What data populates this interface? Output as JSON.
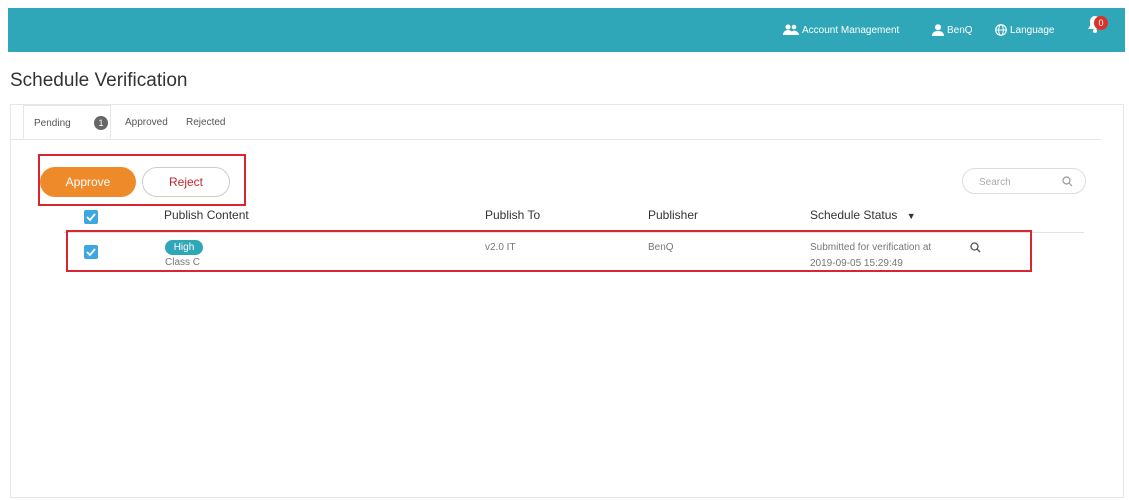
{
  "header": {
    "account_management": "Account Management",
    "user": "BenQ",
    "language": "Language",
    "notification_count": "0"
  },
  "page": {
    "title": "Schedule Verification"
  },
  "tabs": [
    {
      "label": "Pending",
      "count": "1"
    },
    {
      "label": "Approved"
    },
    {
      "label": "Rejected"
    }
  ],
  "actions": {
    "approve": "Approve",
    "reject": "Reject"
  },
  "search": {
    "placeholder": "Search"
  },
  "table": {
    "columns": [
      "Publish Content",
      "Publish To",
      "Publisher",
      "Schedule Status"
    ],
    "rows": [
      {
        "priority": "High",
        "content": "Class C",
        "publish_to": "v2.0 IT",
        "publisher": "BenQ",
        "status_line1": "Submitted for verification at",
        "status_line2": "2019-09-05 15:29:49"
      }
    ]
  },
  "colors": {
    "topbar": "#30a7b8",
    "approve": "#ee8a2a",
    "reject_text": "#c0282e",
    "highlight_box": "#d7262f",
    "checkbox": "#3fa7e0"
  }
}
